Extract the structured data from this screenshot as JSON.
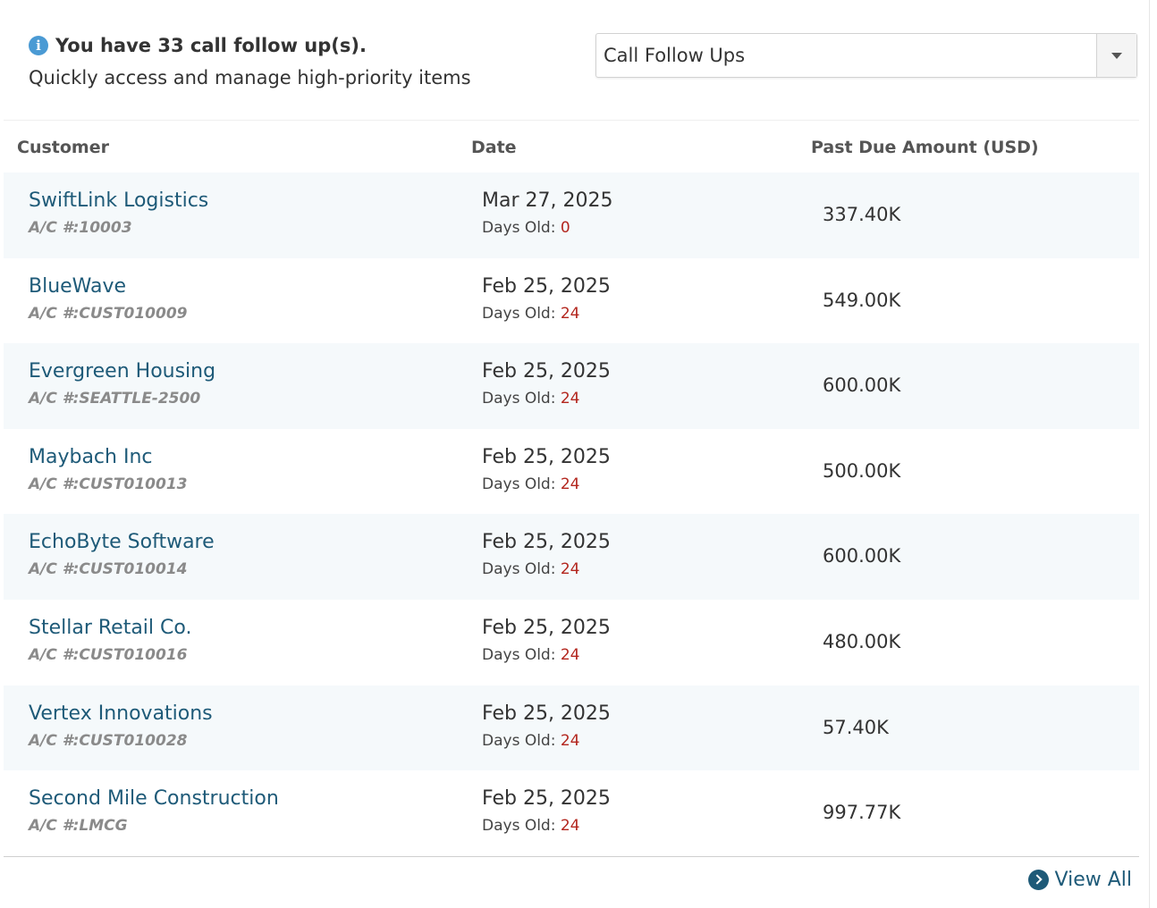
{
  "header": {
    "info_text": "You have 33 call follow up(s).",
    "subtitle": "Quickly access and manage high-priority items"
  },
  "filter": {
    "selected": "Call Follow Ups"
  },
  "table": {
    "columns": [
      "Customer",
      "Date",
      "Past Due Amount (USD)"
    ],
    "days_label": "Days Old: ",
    "rows": [
      {
        "name": "SwiftLink Logistics",
        "ac": "A/C #:10003",
        "date": "Mar 27, 2025",
        "days": "0",
        "amount": "337.40K"
      },
      {
        "name": "BlueWave",
        "ac": "A/C #:CUST010009",
        "date": "Feb 25, 2025",
        "days": "24",
        "amount": "549.00K"
      },
      {
        "name": "Evergreen Housing",
        "ac": "A/C #:SEATTLE-2500",
        "date": "Feb 25, 2025",
        "days": "24",
        "amount": "600.00K"
      },
      {
        "name": "Maybach Inc",
        "ac": "A/C #:CUST010013",
        "date": "Feb 25, 2025",
        "days": "24",
        "amount": "500.00K"
      },
      {
        "name": "EchoByte Software",
        "ac": "A/C #:CUST010014",
        "date": "Feb 25, 2025",
        "days": "24",
        "amount": "600.00K"
      },
      {
        "name": "Stellar Retail Co.",
        "ac": "A/C #:CUST010016",
        "date": "Feb 25, 2025",
        "days": "24",
        "amount": "480.00K"
      },
      {
        "name": "Vertex Innovations",
        "ac": "A/C #:CUST010028",
        "date": "Feb 25, 2025",
        "days": "24",
        "amount": "57.40K"
      },
      {
        "name": "Second Mile Construction",
        "ac": "A/C #:LMCG",
        "date": "Feb 25, 2025",
        "days": "24",
        "amount": "997.77K"
      }
    ]
  },
  "footer": {
    "view_all_label": "View All"
  },
  "icons": {
    "info": "info-circle-icon",
    "view_all": "chevron-circle-right-icon",
    "dropdown": "caret-down-icon"
  },
  "colors": {
    "link": "#1e5a78",
    "days_old": "#b3261e",
    "info": "#4a9ad4",
    "row_alt": "#f5f9fb"
  }
}
